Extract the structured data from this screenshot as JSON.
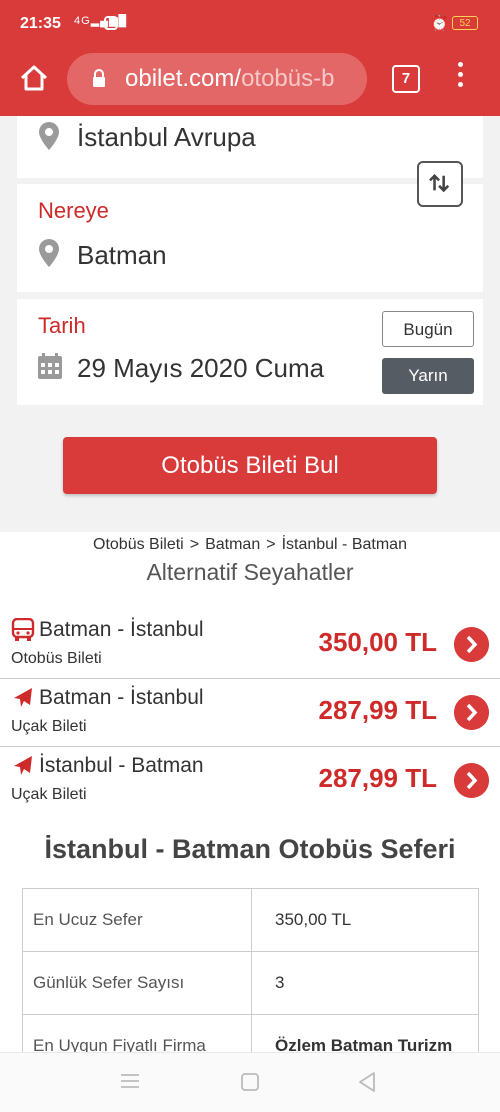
{
  "status": {
    "time": "21:35",
    "signal": "4G",
    "battery": "52"
  },
  "browser": {
    "url_main": "obilet.com/",
    "url_dim": "otobüs-b",
    "tab_count": "7"
  },
  "form": {
    "from_value": "İstanbul Avrupa",
    "to_label": "Nereye",
    "to_value": "Batman",
    "date_label": "Tarih",
    "date_value": "29 Mayıs 2020 Cuma",
    "today_label": "Bugün",
    "tomorrow_label": "Yarın",
    "search_label": "Otobüs Bileti Bul"
  },
  "breadcrumb": {
    "item1": "Otobüs Bileti",
    "sep": ">",
    "item2": "Batman",
    "item3": "İstanbul - Batman"
  },
  "alternatives": {
    "title": "Alternatif Seyahatler",
    "items": [
      {
        "route": "Batman - İstanbul",
        "type": "Otobüs Bileti",
        "price": "350,00 TL",
        "icon": "bus-icon"
      },
      {
        "route": "Batman - İstanbul",
        "type": "Uçak Bileti",
        "price": "287,99 TL",
        "icon": "plane-icon"
      },
      {
        "route": "İstanbul - Batman",
        "type": "Uçak Bileti",
        "price": "287,99 TL",
        "icon": "plane-icon"
      }
    ]
  },
  "sefer": {
    "title": "İstanbul - Batman Otobüs Seferi",
    "rows": [
      {
        "key": "En Ucuz Sefer",
        "value": "350,00 TL"
      },
      {
        "key": "Günlük Sefer Sayısı",
        "value": "3"
      },
      {
        "key": "En Uygun Fiyatlı Firma",
        "value": "Özlem Batman Turizm"
      }
    ]
  },
  "colors": {
    "brand": "#d93a3a",
    "price": "#cf2a2a",
    "active_day": "#555c63"
  }
}
